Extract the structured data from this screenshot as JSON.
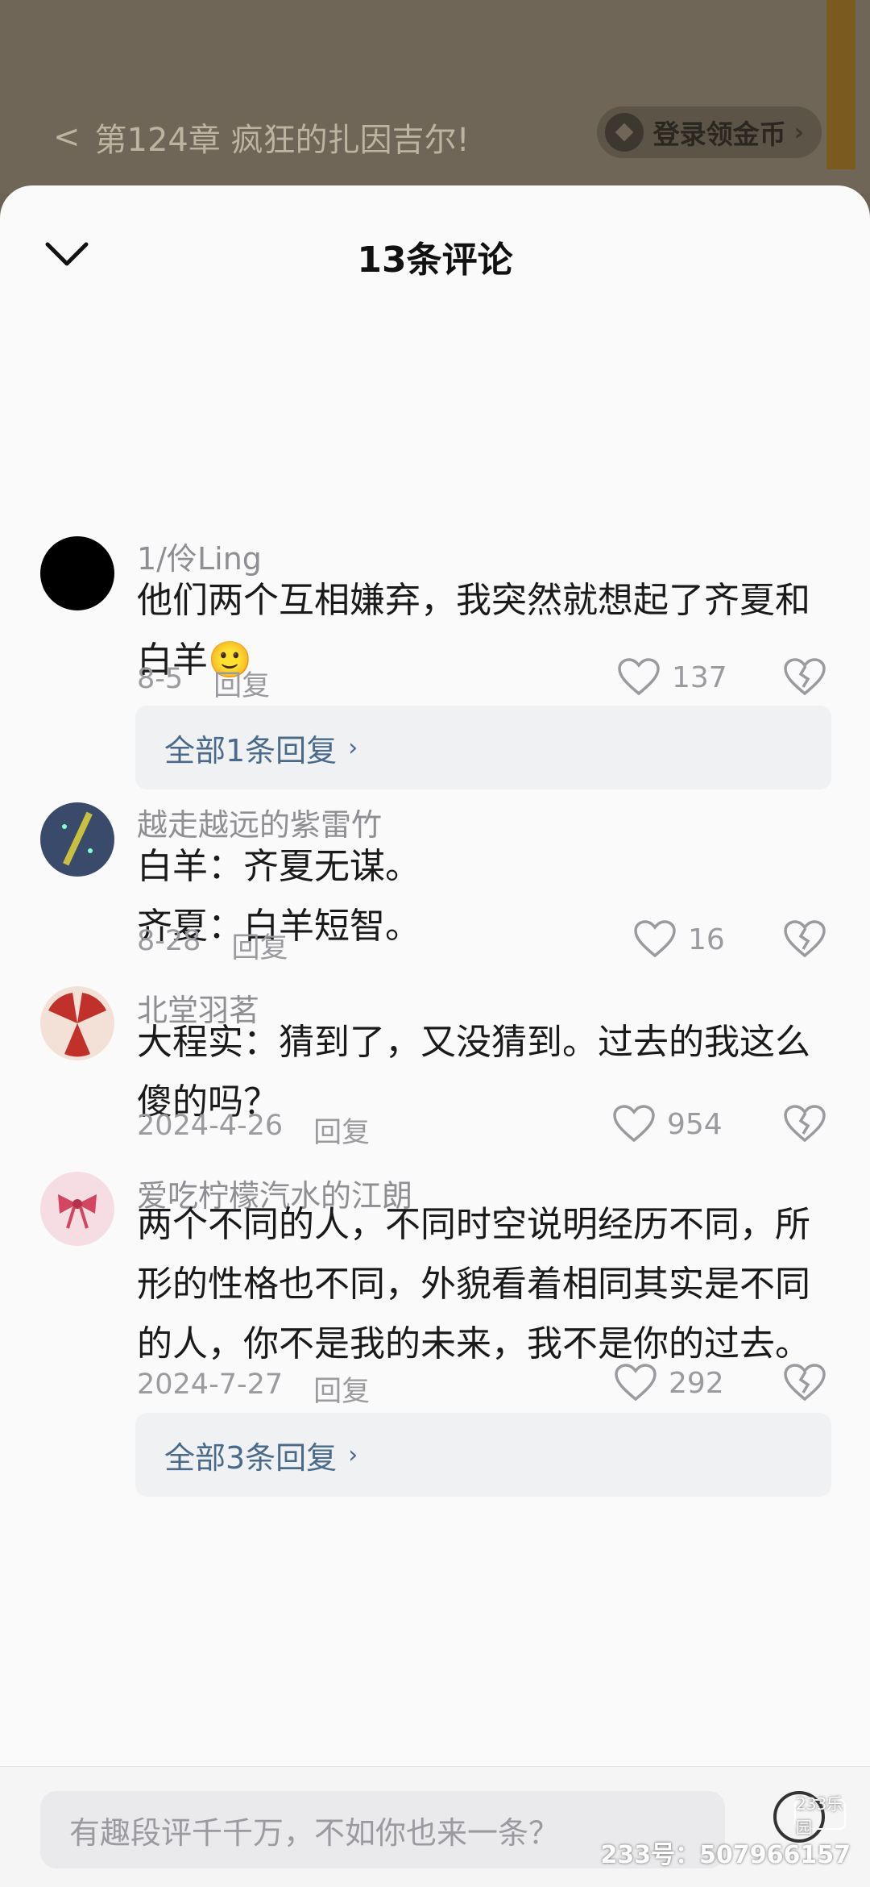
{
  "reader": {
    "chapter_title": "第124章 疯狂的扎因吉尔!",
    "coin_button": "登录领金币"
  },
  "sheet": {
    "title": "13条评论"
  },
  "comments": [
    {
      "user": "1/伶Ling",
      "text": "他们两个互相嫌弃，我突然就想起了齐夏和白羊🙂",
      "date": "8-5",
      "reply": "回复",
      "likes": "137",
      "more_replies": "全部1条回复"
    },
    {
      "user": "越走越远的紫雷竹",
      "text": "白羊：齐夏无谋。\n齐夏：白羊短智。",
      "date": "8-28",
      "reply": "回复",
      "likes": "16"
    },
    {
      "user": "北堂羽茗",
      "text": "大程实：猜到了，又没猜到。过去的我这么傻的吗？",
      "date": "2024-4-26",
      "reply": "回复",
      "likes": "954"
    },
    {
      "user": "爱吃柠檬汽水的江朗",
      "text": "两个不同的人，不同时空说明经历不同，所形的性格也不同，外貌看着相同其实是不同的人，你不是我的未来，我不是你的过去。",
      "date": "2024-7-27",
      "reply": "回复",
      "likes": "292",
      "more_replies": "全部3条回复"
    }
  ],
  "input": {
    "placeholder": "有趣段评千千万，不如你也来一条？"
  },
  "watermark": {
    "logo": "233乐园",
    "id": "233号：507966157"
  }
}
